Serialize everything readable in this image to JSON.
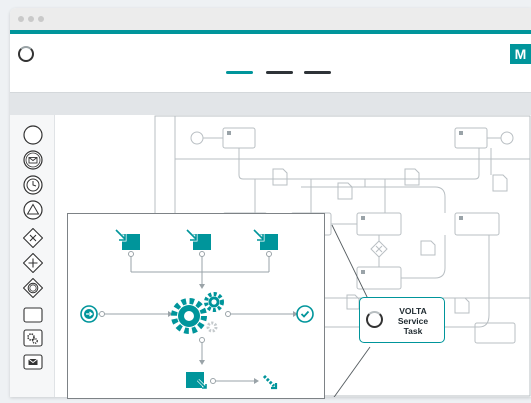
{
  "app": {
    "menu_label": "M",
    "logo_icon": "volta-ring-icon",
    "tabs": [
      {
        "name": "tab-1",
        "active": true
      },
      {
        "name": "tab-2",
        "active": false
      },
      {
        "name": "tab-3",
        "active": false
      }
    ]
  },
  "palette": {
    "items": [
      "start-event-icon",
      "message-event-icon",
      "timer-event-icon",
      "signal-event-icon",
      "exclusive-gateway-icon",
      "parallel-gateway-icon",
      "event-gateway-icon",
      "task-icon",
      "service-task-icon",
      "message-task-icon"
    ]
  },
  "callout": {
    "line1": "VOLTA",
    "line2": "Service",
    "line3": "Task",
    "icon": "volta-ring-icon"
  },
  "colors": {
    "accent": "#00959b",
    "dark": "#333333",
    "diagram_stroke": "#b9bfc3"
  }
}
